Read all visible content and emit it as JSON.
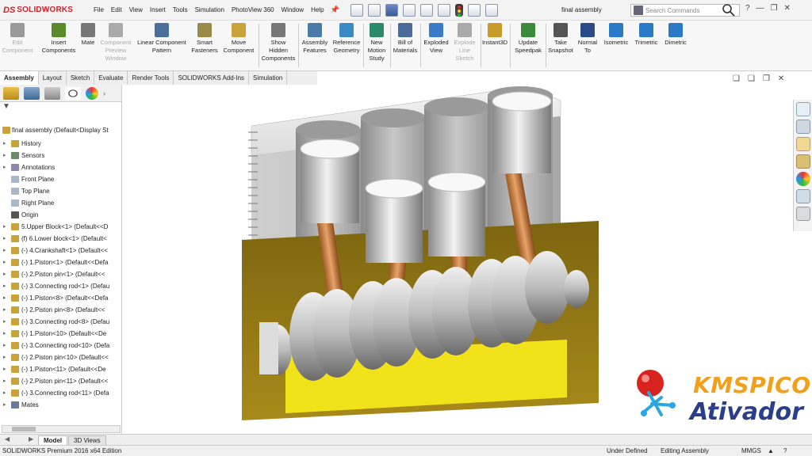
{
  "app": {
    "brand_ds": "DS",
    "brand_name": "SOLIDWORKS",
    "doc_title": "final assembly"
  },
  "menu": [
    "File",
    "Edit",
    "View",
    "Insert",
    "Tools",
    "Simulation",
    "PhotoView 360",
    "Window",
    "Help"
  ],
  "search": {
    "placeholder": "Search Commands"
  },
  "commands": [
    {
      "label": "Edit\nComponent",
      "disabled": true,
      "color": "#9a9a9a"
    },
    {
      "label": "Insert\nComponents",
      "disabled": false,
      "color": "#5a8a2a"
    },
    {
      "label": "Mate",
      "disabled": false,
      "color": "#777"
    },
    {
      "label": "Component\nPreview\nWindow",
      "disabled": true,
      "color": "#aaa"
    },
    {
      "label": "Linear Component\nPattern",
      "disabled": false,
      "color": "#4a6f9a"
    },
    {
      "label": "Smart\nFasteners",
      "disabled": false,
      "color": "#9a8a4a"
    },
    {
      "label": "Move\nComponent",
      "disabled": false,
      "color": "#c9a23a"
    },
    {
      "label": "Show\nHidden\nComponents",
      "disabled": false,
      "color": "#777"
    },
    {
      "label": "Assembly\nFeatures",
      "disabled": false,
      "color": "#4a7aa8"
    },
    {
      "label": "Reference\nGeometry",
      "disabled": false,
      "color": "#3a8ac8"
    },
    {
      "label": "New\nMotion\nStudy",
      "disabled": false,
      "color": "#2a8a6a"
    },
    {
      "label": "Bill of\nMaterials",
      "disabled": false,
      "color": "#4a6a9a"
    },
    {
      "label": "Exploded\nView",
      "disabled": false,
      "color": "#3a7ac8"
    },
    {
      "label": "Explode\nLine\nSketch",
      "disabled": true,
      "color": "#aaa"
    },
    {
      "label": "Instant3D",
      "disabled": false,
      "color": "#c89a2a"
    },
    {
      "label": "Update\nSpeedpak",
      "disabled": false,
      "color": "#3a8a3a"
    },
    {
      "label": "Take\nSnapshot",
      "disabled": false,
      "color": "#555"
    },
    {
      "label": "Normal\nTo",
      "disabled": false,
      "color": "#2a4a8a"
    },
    {
      "label": "Isometric",
      "disabled": false,
      "color": "#2a7ac8"
    },
    {
      "label": "Trimetric",
      "disabled": false,
      "color": "#2a7ac8"
    },
    {
      "label": "Dimetric",
      "disabled": false,
      "color": "#2a7ac8"
    }
  ],
  "tabs": [
    "Assembly",
    "Layout",
    "Sketch",
    "Evaluate",
    "Render Tools",
    "SOLIDWORKS Add-Ins",
    "Simulation"
  ],
  "tree": {
    "root": "final assembly  (Default<Display St",
    "items": [
      {
        "label": "History",
        "icon": "history-icon",
        "color": "#c9a23a"
      },
      {
        "label": "Sensors",
        "icon": "sensors-icon",
        "color": "#6a8a6a"
      },
      {
        "label": "Annotations",
        "icon": "annotations-icon",
        "color": "#8a8aa8"
      },
      {
        "label": "Front Plane",
        "icon": "plane-icon",
        "color": "#a8b8c8"
      },
      {
        "label": "Top Plane",
        "icon": "plane-icon",
        "color": "#a8b8c8"
      },
      {
        "label": "Right Plane",
        "icon": "plane-icon",
        "color": "#a8b8c8"
      },
      {
        "label": "Origin",
        "icon": "origin-icon",
        "color": "#555"
      },
      {
        "label": "5.Upper Block<1> (Default<<D",
        "icon": "part-icon",
        "color": "#c9a23a"
      },
      {
        "label": "(f) 6.Lower block<1> (Default<",
        "icon": "part-icon",
        "color": "#c9a23a"
      },
      {
        "label": "(-) 4.Crankshaft<1> (Default<<",
        "icon": "part-icon",
        "color": "#c9a23a"
      },
      {
        "label": "(-) 1.Piston<1> (Default<<Defa",
        "icon": "part-icon",
        "color": "#c9a23a"
      },
      {
        "label": "(-) 2.Piston pin<1> (Default<<",
        "icon": "part-icon",
        "color": "#c9a23a"
      },
      {
        "label": "(-) 3.Connecting rod<1> (Defau",
        "icon": "part-icon",
        "color": "#c9a23a"
      },
      {
        "label": "(-) 1.Piston<8> (Default<<Defa",
        "icon": "part-icon",
        "color": "#c9a23a"
      },
      {
        "label": "(-) 2.Piston pin<8> (Default<<",
        "icon": "part-icon",
        "color": "#c9a23a"
      },
      {
        "label": "(-) 3.Connecting rod<8> (Defau",
        "icon": "part-icon",
        "color": "#c9a23a"
      },
      {
        "label": "(-) 1.Piston<10> (Default<<De",
        "icon": "part-icon",
        "color": "#c9a23a"
      },
      {
        "label": "(-) 3.Connecting rod<10> (Defa",
        "icon": "part-icon",
        "color": "#c9a23a"
      },
      {
        "label": "(-) 2.Piston pin<10> (Default<<",
        "icon": "part-icon",
        "color": "#c9a23a"
      },
      {
        "label": "(-) 1.Piston<11> (Default<<De",
        "icon": "part-icon",
        "color": "#c9a23a"
      },
      {
        "label": "(-) 2.Piston pin<11> (Default<<",
        "icon": "part-icon",
        "color": "#c9a23a"
      },
      {
        "label": "(-) 3.Connecting rod<11> (Defa",
        "icon": "part-icon",
        "color": "#c9a23a"
      },
      {
        "label": "Mates",
        "icon": "mates-icon",
        "color": "#6a7a9a"
      }
    ]
  },
  "bottom_tabs": [
    "Model",
    "3D Views"
  ],
  "status": {
    "product": "SOLIDWORKS Premium 2016 x64 Edition",
    "defined": "Under Defined",
    "mode": "Editing Assembly",
    "units": "MMGS"
  },
  "watermark": {
    "line1": "KMSPICO",
    "line2": "Ativador"
  }
}
